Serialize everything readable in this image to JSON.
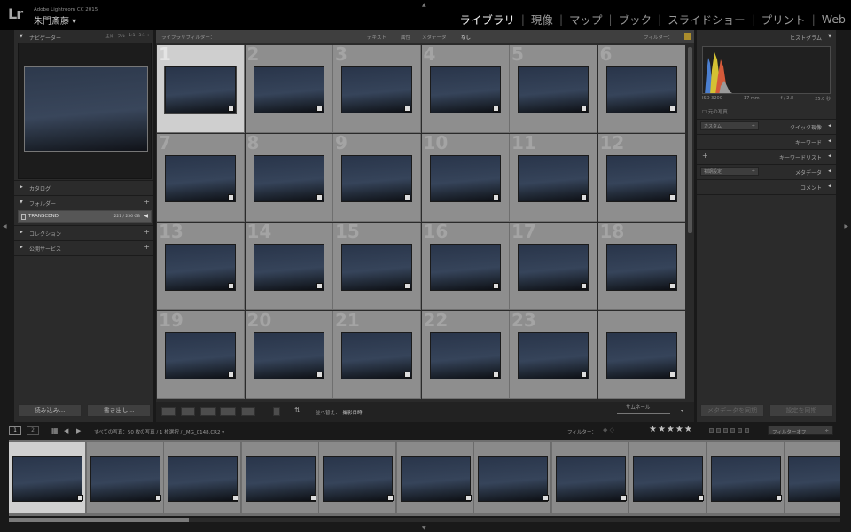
{
  "app": {
    "logo": "Lr",
    "product": "Adobe Lightroom CC 2015",
    "user": "朱門斎藤 ▾"
  },
  "modules": [
    {
      "label": "ライブラリ",
      "active": true
    },
    {
      "label": "現像"
    },
    {
      "label": "マップ"
    },
    {
      "label": "ブック"
    },
    {
      "label": "スライドショー"
    },
    {
      "label": "プリント"
    },
    {
      "label": "Web"
    }
  ],
  "left": {
    "navigator": {
      "title": "ナビゲーター",
      "zoom": [
        "全体",
        "フル",
        "1:1",
        "3:1 ÷"
      ]
    },
    "catalog": "カタログ",
    "folders": "フォルダー",
    "folder_item": {
      "name": "TRANSCEND",
      "size": "221 / 256 GB"
    },
    "collections": "コレクション",
    "publish": "公開サービス",
    "import_btn": "読み込み...",
    "export_btn": "書き出し..."
  },
  "filterbar": {
    "title": "ライブラリフィルター：",
    "text": "テキスト",
    "attribute": "属性",
    "metadata": "メタデータ",
    "none": "なし",
    "filter": "フィルター："
  },
  "grid": {
    "numbers": [
      "1",
      "2",
      "3",
      "4",
      "5",
      "6",
      "7",
      "8",
      "9",
      "10",
      "11",
      "12",
      "13",
      "14",
      "15",
      "16",
      "17",
      "18",
      "19",
      "20",
      "21",
      "22",
      "23",
      ""
    ],
    "selected_index": 0
  },
  "toolbar": {
    "sort_label": "並べ替え：",
    "sort_value": "撮影日時",
    "thumb_label": "サムネール"
  },
  "right": {
    "histogram": "ヒストグラム",
    "iso": "ISO 3200",
    "focal": "17 mm",
    "aperture": "f / 2.8",
    "shutter": "25.0 秒",
    "original": "元の写真",
    "quick_develop": "クイック現像",
    "quick_develop_preset": "カスタム",
    "keywords": "キーワード",
    "keyword_list": "キーワードリスト",
    "metadata": "メタデータ",
    "metadata_preset": "初期設定",
    "comments": "コメント",
    "sync_metadata": "メタデータを同期",
    "sync_settings": "設定を同期"
  },
  "filmstrip": {
    "page1": "1",
    "page2": "2",
    "path": "すべての写真：50 枚の写真 / 1 枚選択 / _MG_0148.CR2 ▾",
    "filter": "フィルター：",
    "stars": "★★★★★",
    "filter_off": "フィルターオフ",
    "count": 11,
    "selected_index": 0
  },
  "colors": {
    "accent_lock": "#ab8d2d"
  }
}
